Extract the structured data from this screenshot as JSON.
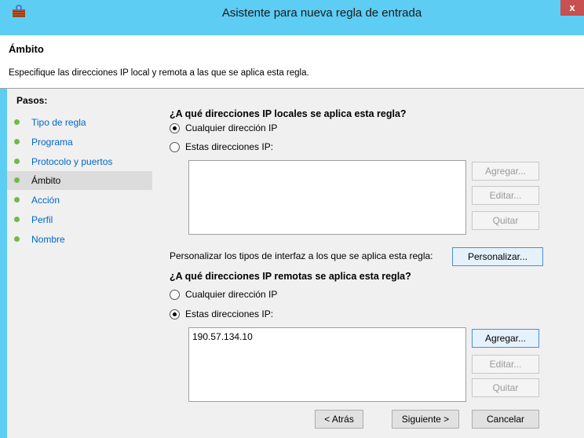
{
  "window": {
    "title": "Asistente para nueva regla de entrada",
    "close_glyph": "x",
    "app_icon": "firewall-icon"
  },
  "header": {
    "title": "Ámbito",
    "description": "Especifique las direcciones IP local y remota a las que se aplica esta regla."
  },
  "sidebar": {
    "label": "Pasos:",
    "steps": [
      {
        "label": "Tipo de regla",
        "active": false
      },
      {
        "label": "Programa",
        "active": false
      },
      {
        "label": "Protocolo y puertos",
        "active": false
      },
      {
        "label": "Ámbito",
        "active": true
      },
      {
        "label": "Acción",
        "active": false
      },
      {
        "label": "Perfil",
        "active": false
      },
      {
        "label": "Nombre",
        "active": false
      }
    ]
  },
  "local": {
    "question": "¿A qué direcciones IP locales se aplica esta regla?",
    "option_any": "Cualquier dirección IP",
    "option_these": "Estas direcciones IP:",
    "selected": "any",
    "addresses": [],
    "buttons": {
      "add": "Agregar...",
      "edit": "Editar...",
      "remove": "Quitar"
    }
  },
  "interfaces": {
    "text": "Personalizar los tipos de interfaz a los que se aplica esta regla:",
    "button": "Personalizar..."
  },
  "remote": {
    "question": "¿A qué direcciones IP remotas se aplica esta regla?",
    "option_any": "Cualquier dirección IP",
    "option_these": "Estas direcciones IP:",
    "selected": "these",
    "addresses": [
      "190.57.134.10"
    ],
    "buttons": {
      "add": "Agregar...",
      "edit": "Editar...",
      "remove": "Quitar"
    }
  },
  "footer": {
    "back": "< Atrás",
    "next": "Siguiente >",
    "cancel": "Cancelar"
  }
}
